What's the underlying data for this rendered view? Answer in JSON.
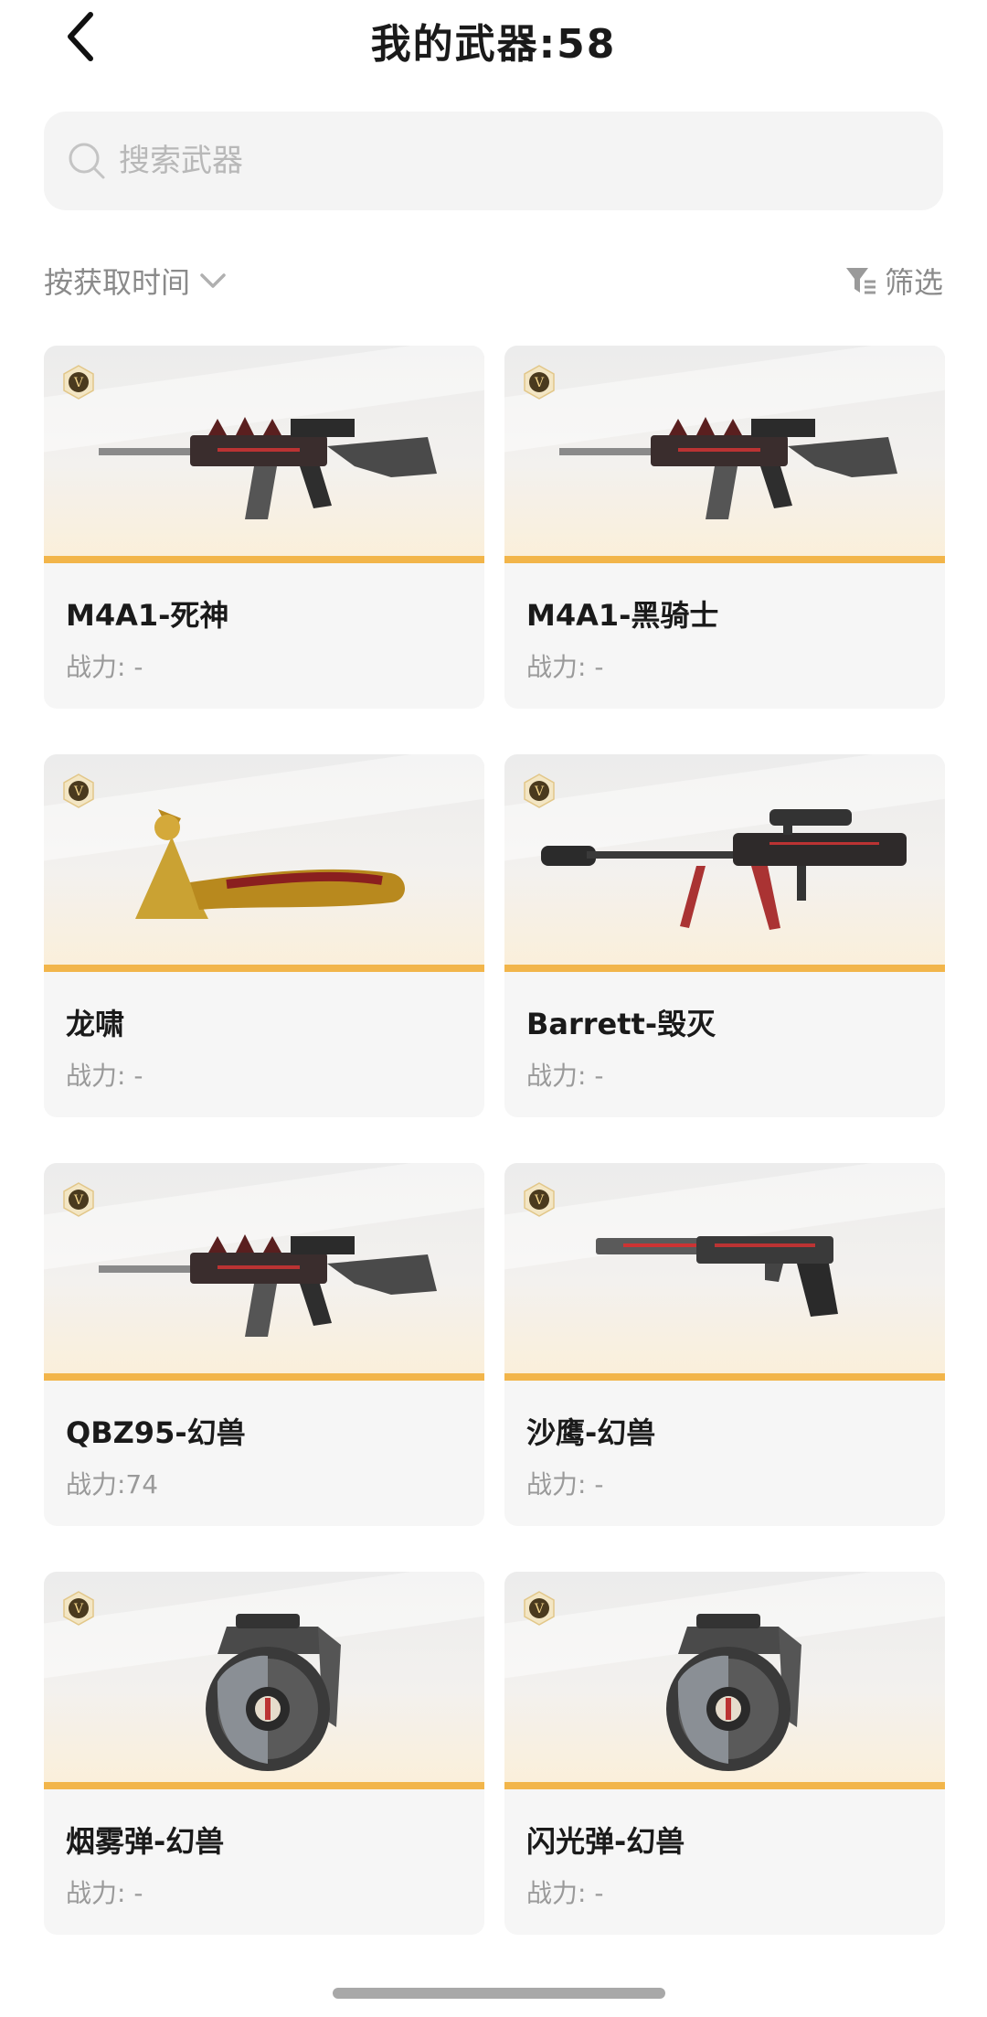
{
  "header": {
    "title": "我的武器:58"
  },
  "search": {
    "placeholder": "搜索武器"
  },
  "sortbar": {
    "sort_label": "按获取时间",
    "filter_label": "筛选"
  },
  "accent_color": "#f2b54a",
  "weapons": [
    {
      "name": "M4A1-死神",
      "power": "战力: -",
      "icon": "rifle-icon"
    },
    {
      "name": "M4A1-黑骑士",
      "power": "战力: -",
      "icon": "rifle-icon"
    },
    {
      "name": "龙啸",
      "power": "战力: -",
      "icon": "axe-icon"
    },
    {
      "name": "Barrett-毁灭",
      "power": "战力: -",
      "icon": "sniper-icon"
    },
    {
      "name": "QBZ95-幻兽",
      "power": "战力:74",
      "icon": "rifle-icon"
    },
    {
      "name": "沙鹰-幻兽",
      "power": "战力: -",
      "icon": "pistol-icon"
    },
    {
      "name": "烟雾弹-幻兽",
      "power": "战力: -",
      "icon": "grenade-icon"
    },
    {
      "name": "闪光弹-幻兽",
      "power": "战力: -",
      "icon": "grenade-icon"
    }
  ]
}
